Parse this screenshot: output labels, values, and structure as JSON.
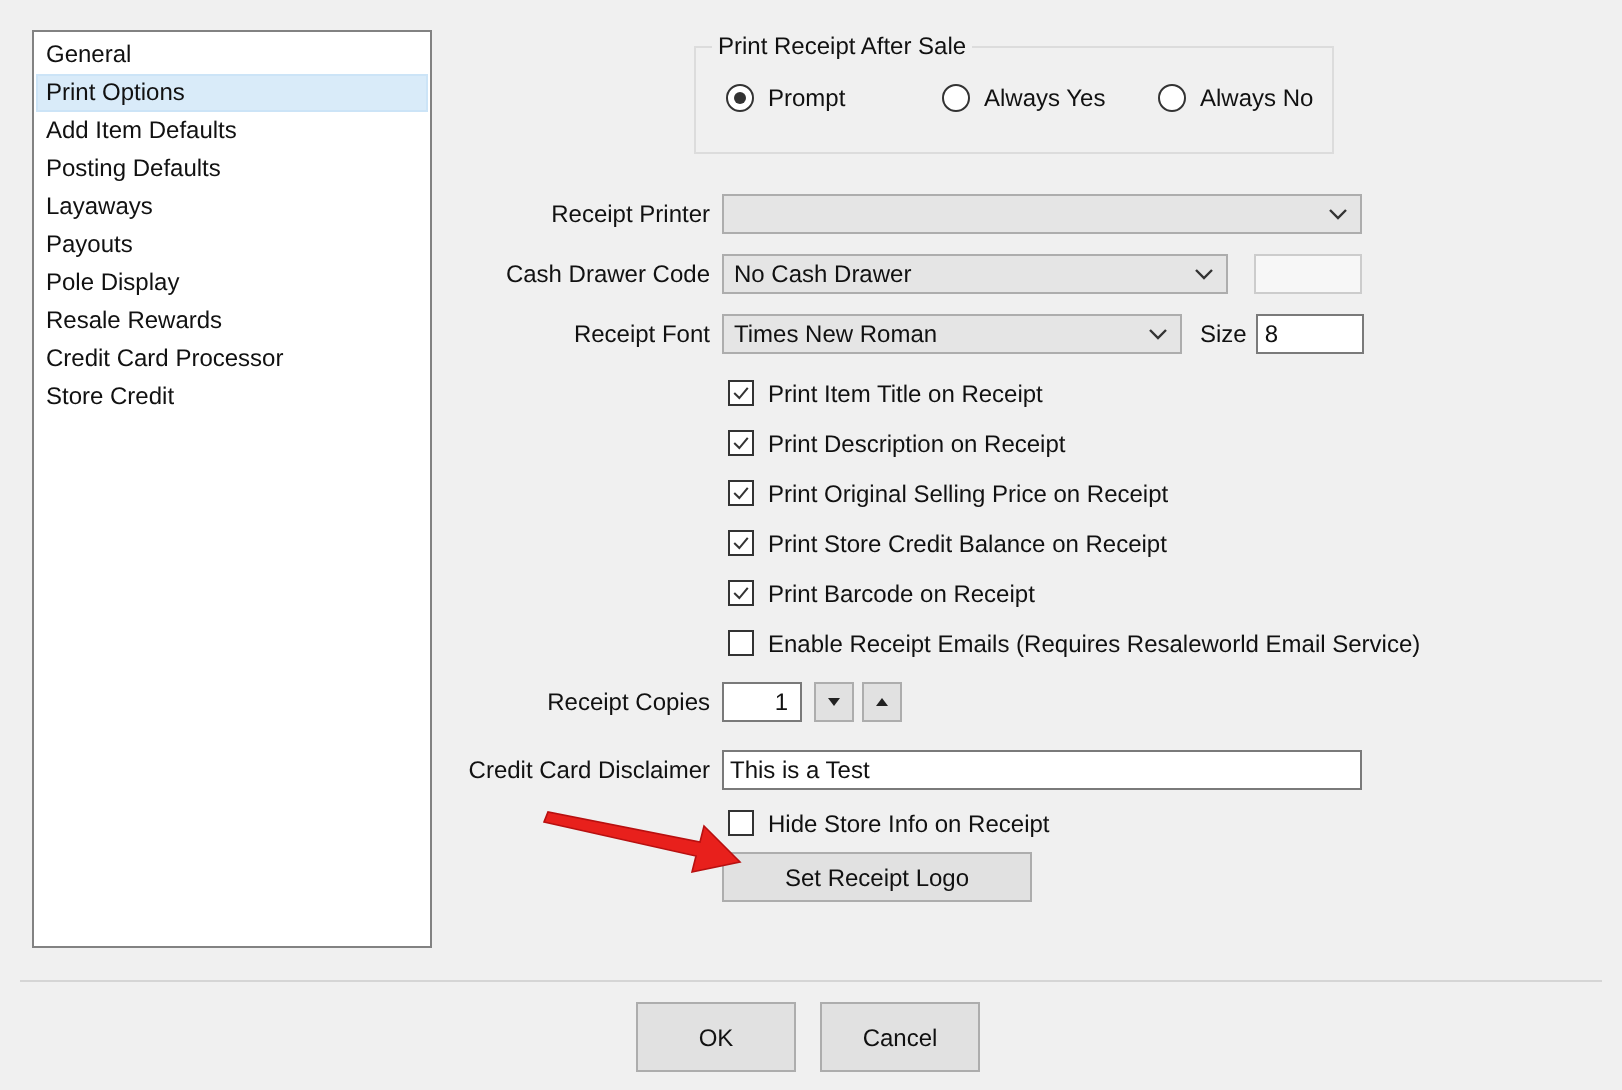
{
  "sidebar": {
    "items": [
      {
        "label": "General",
        "selected": false
      },
      {
        "label": "Print Options",
        "selected": true
      },
      {
        "label": "Add Item Defaults",
        "selected": false
      },
      {
        "label": "Posting Defaults",
        "selected": false
      },
      {
        "label": "Layaways",
        "selected": false
      },
      {
        "label": "Payouts",
        "selected": false
      },
      {
        "label": "Pole Display",
        "selected": false
      },
      {
        "label": "Resale Rewards",
        "selected": false
      },
      {
        "label": "Credit Card Processor",
        "selected": false
      },
      {
        "label": "Store Credit",
        "selected": false
      }
    ]
  },
  "print_after_sale": {
    "title": "Print Receipt After Sale",
    "options": [
      {
        "label": "Prompt",
        "selected": true
      },
      {
        "label": "Always Yes",
        "selected": false
      },
      {
        "label": "Always No",
        "selected": false
      }
    ]
  },
  "receipt_printer": {
    "label": "Receipt Printer"
  },
  "cash_drawer": {
    "label": "Cash Drawer Code",
    "value": "No Cash Drawer"
  },
  "receipt_font": {
    "label": "Receipt Font",
    "value": "Times New Roman",
    "size_label": "Size",
    "size": "8"
  },
  "print_checks": [
    {
      "label": "Print Item Title on Receipt",
      "checked": true
    },
    {
      "label": "Print Description on Receipt",
      "checked": true
    },
    {
      "label": "Print Original Selling Price on Receipt",
      "checked": true
    },
    {
      "label": "Print Store Credit Balance on Receipt",
      "checked": true
    },
    {
      "label": "Print Barcode on Receipt",
      "checked": true
    },
    {
      "label": "Enable Receipt Emails (Requires Resaleworld Email Service)",
      "checked": false
    }
  ],
  "receipt_copies": {
    "label": "Receipt Copies",
    "value": "1"
  },
  "disclaimer": {
    "label": "Credit Card Disclaimer",
    "value": "This is a Test"
  },
  "hide_store_info": {
    "label": "Hide Store Info on Receipt",
    "checked": false
  },
  "logo_button": "Set Receipt Logo",
  "buttons": [
    "OK",
    "Cancel"
  ]
}
